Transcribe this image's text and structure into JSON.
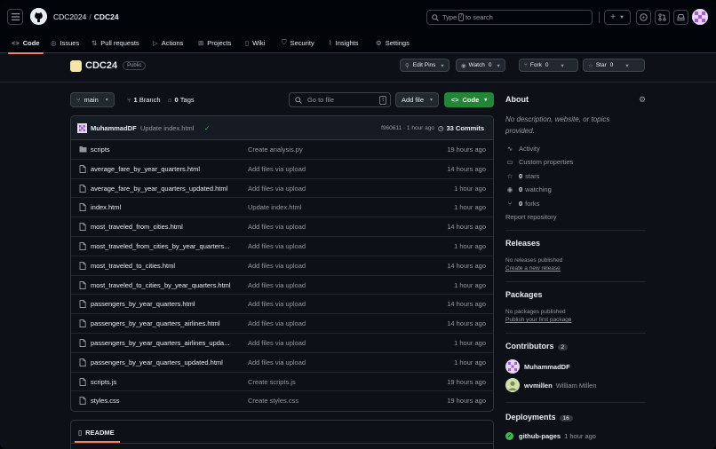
{
  "header": {
    "owner": "CDC2024",
    "separator": "/",
    "repo": "CDC24",
    "search_prefix": "Type",
    "search_key": "/",
    "search_suffix": "to search"
  },
  "tabs": [
    {
      "label": "Code",
      "icon": "code-icon"
    },
    {
      "label": "Issues",
      "icon": "issue-icon"
    },
    {
      "label": "Pull requests",
      "icon": "pull-request-icon"
    },
    {
      "label": "Actions",
      "icon": "play-icon"
    },
    {
      "label": "Projects",
      "icon": "table-icon"
    },
    {
      "label": "Wiki",
      "icon": "book-icon"
    },
    {
      "label": "Security",
      "icon": "shield-icon"
    },
    {
      "label": "Insights",
      "icon": "graph-icon"
    },
    {
      "label": "Settings",
      "icon": "gear-icon"
    }
  ],
  "repo": {
    "name": "CDC24",
    "visibility": "Public",
    "edit_pins": "Edit Pins",
    "watch_label": "Watch",
    "watch_count": "0",
    "fork_label": "Fork",
    "fork_count": "0",
    "star_label": "Star",
    "star_count": "0"
  },
  "toolbar": {
    "branch": "main",
    "branches_count": "1",
    "branches_label": "Branch",
    "tags_count": "0",
    "tags_label": "Tags",
    "go_to_file": "Go to file",
    "go_to_file_key": "t",
    "add_file": "Add file",
    "code": "Code"
  },
  "latest_commit": {
    "author": "MuhammadDF",
    "message": "Update index.html",
    "check": "✓",
    "sha_time": "f960611 · 1 hour ago",
    "commits": "33 Commits"
  },
  "files": [
    {
      "type": "folder",
      "name": "scripts",
      "message": "Create analysis.py",
      "age": "19 hours ago"
    },
    {
      "type": "file",
      "name": "average_fare_by_year_quarters.html",
      "message": "Add files via upload",
      "age": "14 hours ago"
    },
    {
      "type": "file",
      "name": "average_fare_by_year_quarters_updated.html",
      "message": "Add files via upload",
      "age": "1 hour ago"
    },
    {
      "type": "file",
      "name": "index.html",
      "message": "Update index.html",
      "age": "1 hour ago"
    },
    {
      "type": "file",
      "name": "most_traveled_from_cities.html",
      "message": "Add files via upload",
      "age": "14 hours ago"
    },
    {
      "type": "file",
      "name": "most_traveled_from_cities_by_year_quarters...",
      "message": "Add files via upload",
      "age": "1 hour ago"
    },
    {
      "type": "file",
      "name": "most_traveled_to_cities.html",
      "message": "Add files via upload",
      "age": "14 hours ago"
    },
    {
      "type": "file",
      "name": "most_traveled_to_cities_by_year_quarters.html",
      "message": "Add files via upload",
      "age": "1 hour ago"
    },
    {
      "type": "file",
      "name": "passengers_by_year_quarters.html",
      "message": "Add files via upload",
      "age": "14 hours ago"
    },
    {
      "type": "file",
      "name": "passengers_by_year_quarters_airlines.html",
      "message": "Add files via upload",
      "age": "14 hours ago"
    },
    {
      "type": "file",
      "name": "passengers_by_year_quarters_airlines_upda...",
      "message": "Add files via upload",
      "age": "1 hour ago"
    },
    {
      "type": "file",
      "name": "passengers_by_year_quarters_updated.html",
      "message": "Add files via upload",
      "age": "1 hour ago"
    },
    {
      "type": "file",
      "name": "scripts.js",
      "message": "Create scripts.js",
      "age": "19 hours ago"
    },
    {
      "type": "file",
      "name": "styles.css",
      "message": "Create styles.css",
      "age": "19 hours ago"
    }
  ],
  "readme": {
    "label": "README"
  },
  "about": {
    "title": "About",
    "description": "No description, website, or topics provided.",
    "activity": "Activity",
    "custom_properties": "Custom properties",
    "stars_count": "0",
    "stars_label": "stars",
    "watching_count": "0",
    "watching_label": "watching",
    "forks_count": "0",
    "forks_label": "forks",
    "report": "Report repository"
  },
  "releases": {
    "title": "Releases",
    "empty": "No releases published",
    "link": "Create a new release"
  },
  "packages": {
    "title": "Packages",
    "empty": "No packages published",
    "link": "Publish your first package"
  },
  "contributors": {
    "title": "Contributors",
    "count": "2",
    "people": [
      {
        "login": "MuhammadDF",
        "name": "",
        "avatar_color": "#c9a3e6"
      },
      {
        "login": "wvmillen",
        "name": "William Millen",
        "avatar_color": "#d7e6b0"
      }
    ]
  },
  "deployments": {
    "title": "Deployments",
    "count": "16",
    "name": "github-pages",
    "time": "1 hour ago"
  },
  "colors": {
    "accent_tab": "#f78166",
    "code_button": "#238636",
    "success": "#3fb950",
    "background": "#0d1117",
    "header_background": "#010409"
  }
}
